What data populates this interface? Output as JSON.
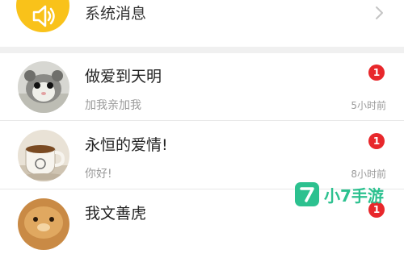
{
  "system_message": {
    "label": "系统消息",
    "icon": "speaker-icon",
    "accent_color": "#f9c21a"
  },
  "chats": [
    {
      "name": "做爱到天明",
      "preview": "加我亲加我",
      "time": "5小时前",
      "unread": "1",
      "avatar": "hamster-avatar"
    },
    {
      "name": "永恒的爱情!",
      "preview": "你好!",
      "time": "8小时前",
      "unread": "1",
      "avatar": "coffee-cup-avatar"
    },
    {
      "name": "我文善虎",
      "unread": "1",
      "avatar": "hamster-avatar"
    }
  ],
  "badge_color": "#e8272b",
  "watermark": {
    "text": "小7手游",
    "glyph": "7",
    "color": "#2cc18f"
  }
}
